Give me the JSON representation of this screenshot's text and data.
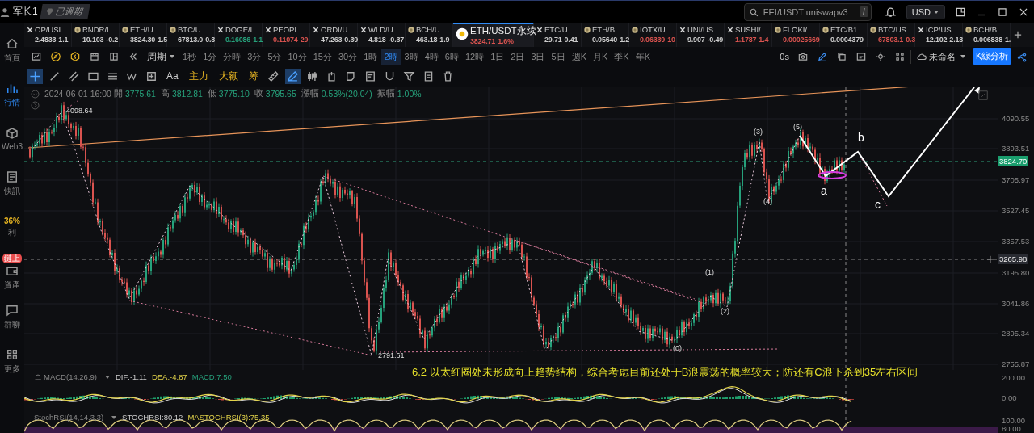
{
  "user": {
    "name": "军长1",
    "badge": "已過期"
  },
  "search": {
    "placeholder": "FEI/USDT uniswapv3",
    "shortcut": "/"
  },
  "currency": "USD",
  "sidebar": [
    {
      "kind": "home",
      "label": "首頁",
      "selected": false
    },
    {
      "kind": "market",
      "label": "行情",
      "selected": true
    },
    {
      "kind": "web3",
      "label": "Web3",
      "selected": false
    },
    {
      "kind": "news",
      "label": "快訊",
      "selected": false
    },
    {
      "kind": "promo",
      "promo": "36%",
      "label": "利",
      "selected": false
    },
    {
      "kind": "assets",
      "badge": "鏈上",
      "label": "資產",
      "selected": false
    },
    {
      "kind": "chat",
      "label": "群聊",
      "selected": false
    },
    {
      "kind": "more",
      "label": "更多",
      "selected": false
    }
  ],
  "tickers": [
    {
      "kind": "cross",
      "symbol": "OP/USI",
      "price": "2.4833",
      "change": "1.1",
      "color": "#cccccc",
      "selected": false
    },
    {
      "kind": "coin",
      "symbol": "RNDR/I",
      "price": "10.103",
      "change": "-0.2",
      "color": "#cccccc",
      "selected": false
    },
    {
      "kind": "coin",
      "symbol": "ETH/U",
      "price": "3824.30",
      "change": "1.5",
      "color": "#cccccc",
      "selected": false
    },
    {
      "kind": "coin",
      "symbol": "BTC/U",
      "price": "67813.0",
      "change": "0.3",
      "color": "#cccccc",
      "selected": false
    },
    {
      "kind": "cross",
      "symbol": "DOGE/I",
      "price": "0.16086",
      "change": "1.1",
      "color": "#26a17b",
      "selected": false
    },
    {
      "kind": "cross",
      "symbol": "PEOPL",
      "price": "0.11074",
      "change": "29",
      "color": "#d9534f",
      "selected": false
    },
    {
      "kind": "cross",
      "symbol": "ORDI/U",
      "price": "47.263",
      "change": "0.39",
      "color": "#cccccc",
      "selected": false
    },
    {
      "kind": "cross",
      "symbol": "WLD/U",
      "price": "4.818",
      "change": "-0.37",
      "color": "#cccccc",
      "selected": false
    },
    {
      "kind": "coin",
      "symbol": "BCH/U",
      "price": "463.18",
      "change": "1.9",
      "color": "#cccccc",
      "selected": false
    },
    {
      "kind": "coin",
      "symbol": "ETH/USDT永续",
      "price": "3824.71",
      "change": "1.6%",
      "color": "#d9534f",
      "selected": true
    },
    {
      "kind": "cross",
      "symbol": "ETC/U",
      "price": "29.71",
      "change": "0.41",
      "color": "#cccccc",
      "selected": false
    },
    {
      "kind": "coin",
      "symbol": "ETH/B",
      "price": "0.05640",
      "change": "1.2",
      "color": "#cccccc",
      "selected": false
    },
    {
      "kind": "coin",
      "symbol": "IOTX/U",
      "price": "0.06339",
      "change": "10",
      "color": "#d9534f",
      "selected": false
    },
    {
      "kind": "cross",
      "symbol": "UNI/US",
      "price": "9.907",
      "change": "-0.49",
      "color": "#cccccc",
      "selected": false
    },
    {
      "kind": "cross",
      "symbol": "SUSHI/",
      "price": "1.1787",
      "change": "1.4",
      "color": "#d9534f",
      "selected": false
    },
    {
      "kind": "coin",
      "symbol": "FLOKI/",
      "price": "0.00025669",
      "color": "#d9534f",
      "selected": false
    },
    {
      "kind": "coin",
      "symbol": "ETC/B1",
      "price": "0.0004379",
      "color": "#cccccc",
      "selected": false
    },
    {
      "kind": "coin",
      "symbol": "BTC/US",
      "price": "67803.1",
      "change": "0.3",
      "color": "#d9534f",
      "selected": false
    },
    {
      "kind": "cross",
      "symbol": "ICP/US",
      "price": "12.102",
      "change": "2.13",
      "color": "#cccccc",
      "selected": false
    },
    {
      "kind": "coin",
      "symbol": "BCH/B",
      "price": "0.006838",
      "change": "1.",
      "color": "#cccccc",
      "selected": false
    }
  ],
  "period_label": "周期",
  "intervals": [
    {
      "label": "1秒",
      "selected": false
    },
    {
      "label": "1分",
      "selected": false
    },
    {
      "label": "分時",
      "selected": false
    },
    {
      "label": "3分",
      "selected": false
    },
    {
      "label": "5分",
      "selected": false
    },
    {
      "label": "10分",
      "selected": false
    },
    {
      "label": "15分",
      "selected": false
    },
    {
      "label": "30分",
      "selected": false
    },
    {
      "label": "1時",
      "selected": false
    },
    {
      "label": "2時",
      "selected": true
    },
    {
      "label": "3時",
      "selected": false
    },
    {
      "label": "4時",
      "selected": false
    },
    {
      "label": "6時",
      "selected": false
    },
    {
      "label": "12時",
      "selected": false
    },
    {
      "label": "1日",
      "selected": false
    },
    {
      "label": "2日",
      "selected": false
    },
    {
      "label": "3日",
      "selected": false
    },
    {
      "label": "5日",
      "selected": false
    },
    {
      "label": "週K",
      "selected": false
    },
    {
      "label": "月K",
      "selected": false
    },
    {
      "label": "季K",
      "selected": false
    },
    {
      "label": "年K",
      "selected": false
    }
  ],
  "countdown": "0s",
  "layout_name": "未命名",
  "analysis_button": "K線分析",
  "drawing_tools": [
    {
      "kind": "crosshair",
      "selected": true
    },
    {
      "kind": "line",
      "selected": false
    },
    {
      "kind": "parallel",
      "selected": false
    },
    {
      "kind": "rect",
      "selected": false
    },
    {
      "kind": "hlines",
      "selected": false
    },
    {
      "kind": "wave",
      "selected": false
    },
    {
      "kind": "plusbox",
      "selected": false
    },
    {
      "kind": "text",
      "label": "Aa",
      "selected": false
    },
    {
      "kind": "indicator",
      "label": "主力",
      "selected": false
    },
    {
      "kind": "indicator",
      "label": "大额",
      "selected": false
    },
    {
      "kind": "indicator",
      "label": "筹",
      "selected": false
    },
    {
      "kind": "ruler",
      "selected": false
    },
    {
      "kind": "pen",
      "selected": true
    },
    {
      "kind": "candles",
      "selected": false
    },
    {
      "kind": "box",
      "selected": false
    },
    {
      "kind": "comment",
      "selected": false
    },
    {
      "kind": "note",
      "selected": false
    },
    {
      "kind": "magnet",
      "selected": false
    },
    {
      "kind": "filter",
      "selected": false
    },
    {
      "kind": "swap",
      "selected": false
    },
    {
      "kind": "trash",
      "selected": false
    }
  ],
  "chart_header": {
    "datetime": "2024-06-01 16:00",
    "fields": [
      {
        "label": "開",
        "value": "3775.61"
      },
      {
        "label": "高",
        "value": "3812.81"
      },
      {
        "label": "低",
        "value": "3775.10"
      },
      {
        "label": "收",
        "value": "3795.65"
      },
      {
        "label": "漲幅",
        "value": "0.53%(20.04)"
      },
      {
        "label": "振幅",
        "value": "1.00%"
      }
    ]
  },
  "chart_labels": [
    {
      "kind": "price",
      "text": "4098.64"
    },
    {
      "kind": "price",
      "text": "2791.61"
    },
    {
      "kind": "wave",
      "text": "(0)"
    },
    {
      "kind": "wave",
      "text": "(1)"
    },
    {
      "kind": "wave",
      "text": "(2)"
    },
    {
      "kind": "wave",
      "text": "(3)"
    },
    {
      "kind": "wave",
      "text": "(4)"
    },
    {
      "kind": "wave",
      "text": "(5)"
    },
    {
      "kind": "letter",
      "text": "a"
    },
    {
      "kind": "letter",
      "text": "b"
    },
    {
      "kind": "letter",
      "text": "c"
    }
  ],
  "note": "6.2 以太红圈处未形成向上趋势结构，综合考虑目前还处于B浪震荡的概率较大；防还有C浪下杀到35左右区间",
  "macd": {
    "name": "MACD(14,26,9)",
    "dif": "DIF:-1.11",
    "dea": "DEA:-4.87",
    "macd": "MACD:7.50"
  },
  "stoch_rsi": {
    "name": "StochRSI(14,14,3,3)",
    "k": "STOCHRSI:80.12",
    "d": "MASTOCHRSI(3):75.35"
  },
  "price_axis": [
    {
      "kind": "tick",
      "text": "4090.55"
    },
    {
      "kind": "tick",
      "text": "3893.51"
    },
    {
      "kind": "last",
      "text": "3824.70"
    },
    {
      "kind": "tick",
      "text": "3705.97"
    },
    {
      "kind": "tick",
      "text": "3527.45"
    },
    {
      "kind": "tick",
      "text": "3357.53"
    },
    {
      "kind": "crosshair",
      "text": "3265.98"
    },
    {
      "kind": "tick",
      "text": "3195.80"
    },
    {
      "kind": "tick",
      "text": "3041.86"
    },
    {
      "kind": "tick",
      "text": "2895.34"
    },
    {
      "kind": "tick",
      "text": "2755.87"
    },
    {
      "kind": "tick",
      "text": "200.00"
    },
    {
      "kind": "tick",
      "text": "0.00"
    },
    {
      "kind": "tick",
      "text": "100.00"
    },
    {
      "kind": "tick",
      "text": "80.00"
    }
  ]
}
